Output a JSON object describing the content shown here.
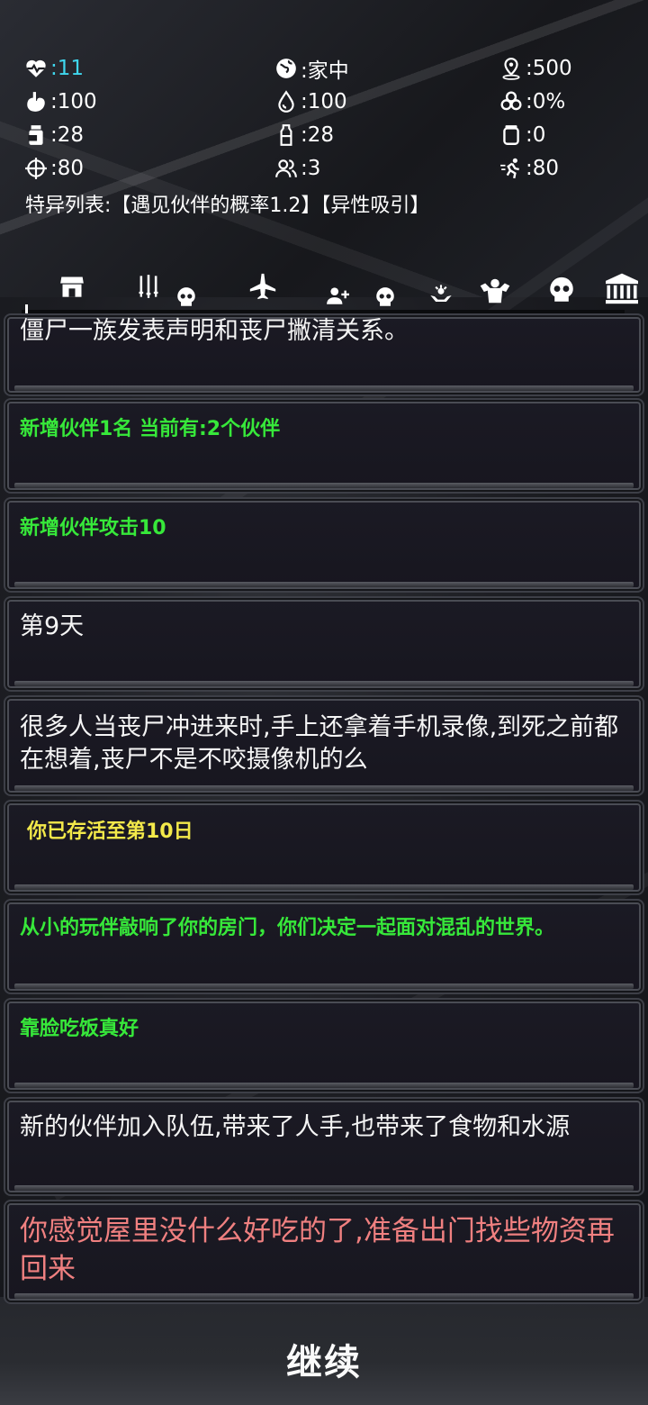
{
  "stats": {
    "health": ":11",
    "location": ":家中",
    "distance": ":500",
    "hunger": ":100",
    "thirst": ":100",
    "infection": ":0%",
    "food": ":28",
    "water": ":28",
    "ammo": ":0",
    "attack": ":80",
    "companions": ":3",
    "agility": ":80",
    "colors": {
      "health": "#3fd7ee",
      "default": "#ffffff"
    }
  },
  "traits": "特异列表:【遇见伙伴的概率1.2】【异性吸引】",
  "tabs": [
    {
      "icon": "shop-icon"
    },
    {
      "icon": "weapons-icon"
    },
    {
      "icon": "skull-icon"
    },
    {
      "icon": "airplane-icon"
    },
    {
      "icon": "add-companion-icon"
    },
    {
      "icon": "skull-icon"
    },
    {
      "icon": "bio-hand-icon"
    },
    {
      "icon": "muscle-icon"
    },
    {
      "icon": "skull-icon"
    },
    {
      "icon": "bank-icon"
    }
  ],
  "log": [
    {
      "text": "僵尸一族发表声明和丧尸撇清关系。",
      "style": "white"
    },
    {
      "text": "新增伙伴1名  当前有:2个伙伴",
      "style": "green"
    },
    {
      "text": "新增伙伴攻击10",
      "style": "green"
    },
    {
      "text": "第9天",
      "style": "white"
    },
    {
      "text": "很多人当丧尸冲进来时,手上还拿着手机录像,到死之前都在想着,丧尸不是不咬摄像机的么",
      "style": "white"
    },
    {
      "text": "你已存活至第10日",
      "style": "yellow"
    },
    {
      "text": "从小的玩伴敲响了你的房门，你们决定一起面对混乱的世界。",
      "style": "green"
    },
    {
      "text": "靠脸吃饭真好",
      "style": "green"
    },
    {
      "text": "新的伙伴加入队伍,带来了人手,也带来了食物和水源",
      "style": "white"
    },
    {
      "text": "你感觉屋里没什么好吃的了,准备出门找些物资再回来",
      "style": "red"
    }
  ],
  "continue_label": "继续"
}
